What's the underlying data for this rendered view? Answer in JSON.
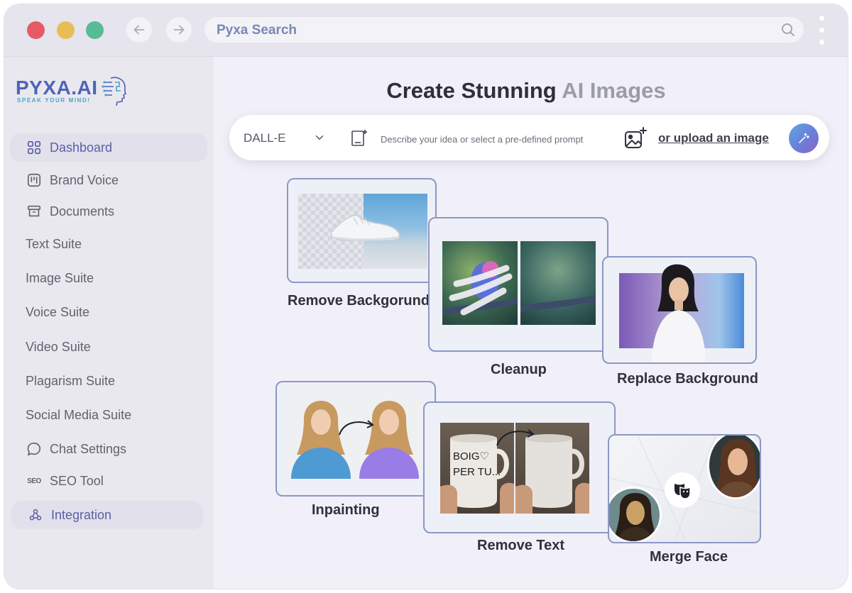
{
  "browser": {
    "url_title": "Pyxa Search"
  },
  "brand": {
    "name": "PYXA.AI",
    "tagline": "SPEAK YOUR MIND!"
  },
  "sidebar": {
    "items": [
      {
        "label": "Dashboard",
        "icon": "grid-icon",
        "active": true
      },
      {
        "label": "Brand Voice",
        "icon": "kanban-icon"
      },
      {
        "label": "Documents",
        "icon": "archive-icon"
      },
      {
        "label": "Text Suite"
      },
      {
        "label": "Image Suite"
      },
      {
        "label": "Voice Suite"
      },
      {
        "label": "Video Suite"
      },
      {
        "label": "Plagarism Suite"
      },
      {
        "label": "Social Media Suite"
      },
      {
        "label": "Chat Settings",
        "icon": "chat-bubble-icon"
      },
      {
        "label": "SEO Tool",
        "icon": "seo-icon",
        "icon_text": "SEO"
      },
      {
        "label": "Integration",
        "icon": "webhook-icon",
        "active": true
      }
    ]
  },
  "main": {
    "headline_main": "Create Stunning",
    "headline_accent": "AI Images",
    "prompt": {
      "model": "DALL-E",
      "placeholder": "Describe your idea or select a pre-defined prompt",
      "upload_label": "or upload an image"
    },
    "tools": [
      {
        "label": "Remove Backgorund"
      },
      {
        "label": "Cleanup"
      },
      {
        "label": "Replace Background"
      },
      {
        "label": "Inpainting"
      },
      {
        "label": "Remove Text",
        "mug_text": "BOIG♡ PER TU..."
      },
      {
        "label": "Merge Face"
      }
    ]
  },
  "colors": {
    "accent": "#5b5fa8",
    "card_border": "#8c98c6",
    "url_text": "#7a86b8"
  }
}
